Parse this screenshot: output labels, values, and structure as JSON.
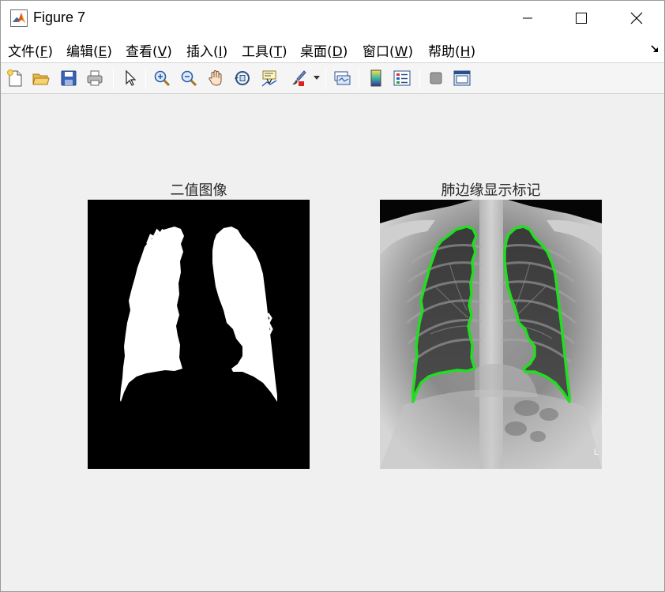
{
  "window": {
    "title": "Figure 7"
  },
  "menu": [
    {
      "label": "文件(",
      "key": "F",
      "end": ")"
    },
    {
      "label": "编辑(",
      "key": "E",
      "end": ")"
    },
    {
      "label": "查看(",
      "key": "V",
      "end": ")"
    },
    {
      "label": "插入(",
      "key": "I",
      "end": ")"
    },
    {
      "label": "工具(",
      "key": "T",
      "end": ")"
    },
    {
      "label": "桌面(",
      "key": "D",
      "end": ")"
    },
    {
      "label": "窗口(",
      "key": "W",
      "end": ")"
    },
    {
      "label": "帮助(",
      "key": "H",
      "end": ")"
    }
  ],
  "toolbar": {
    "icons": [
      "new-figure-icon",
      "open-file-icon",
      "save-icon",
      "print-icon",
      "select-arrow-icon",
      "zoom-in-icon",
      "zoom-out-icon",
      "pan-hand-icon",
      "rotate-3d-icon",
      "data-cursor-icon",
      "brush-icon",
      "link-plot-icon",
      "colorbar-icon",
      "legend-icon",
      "hide-plot-tools-icon",
      "show-plot-tools-icon"
    ]
  },
  "axes_left": {
    "title": "二值图像"
  },
  "axes_right": {
    "title": "肺边缘显示标记",
    "corner_label": "L"
  },
  "colors": {
    "outline": "#22dd22",
    "background": "#f0f0f0"
  }
}
